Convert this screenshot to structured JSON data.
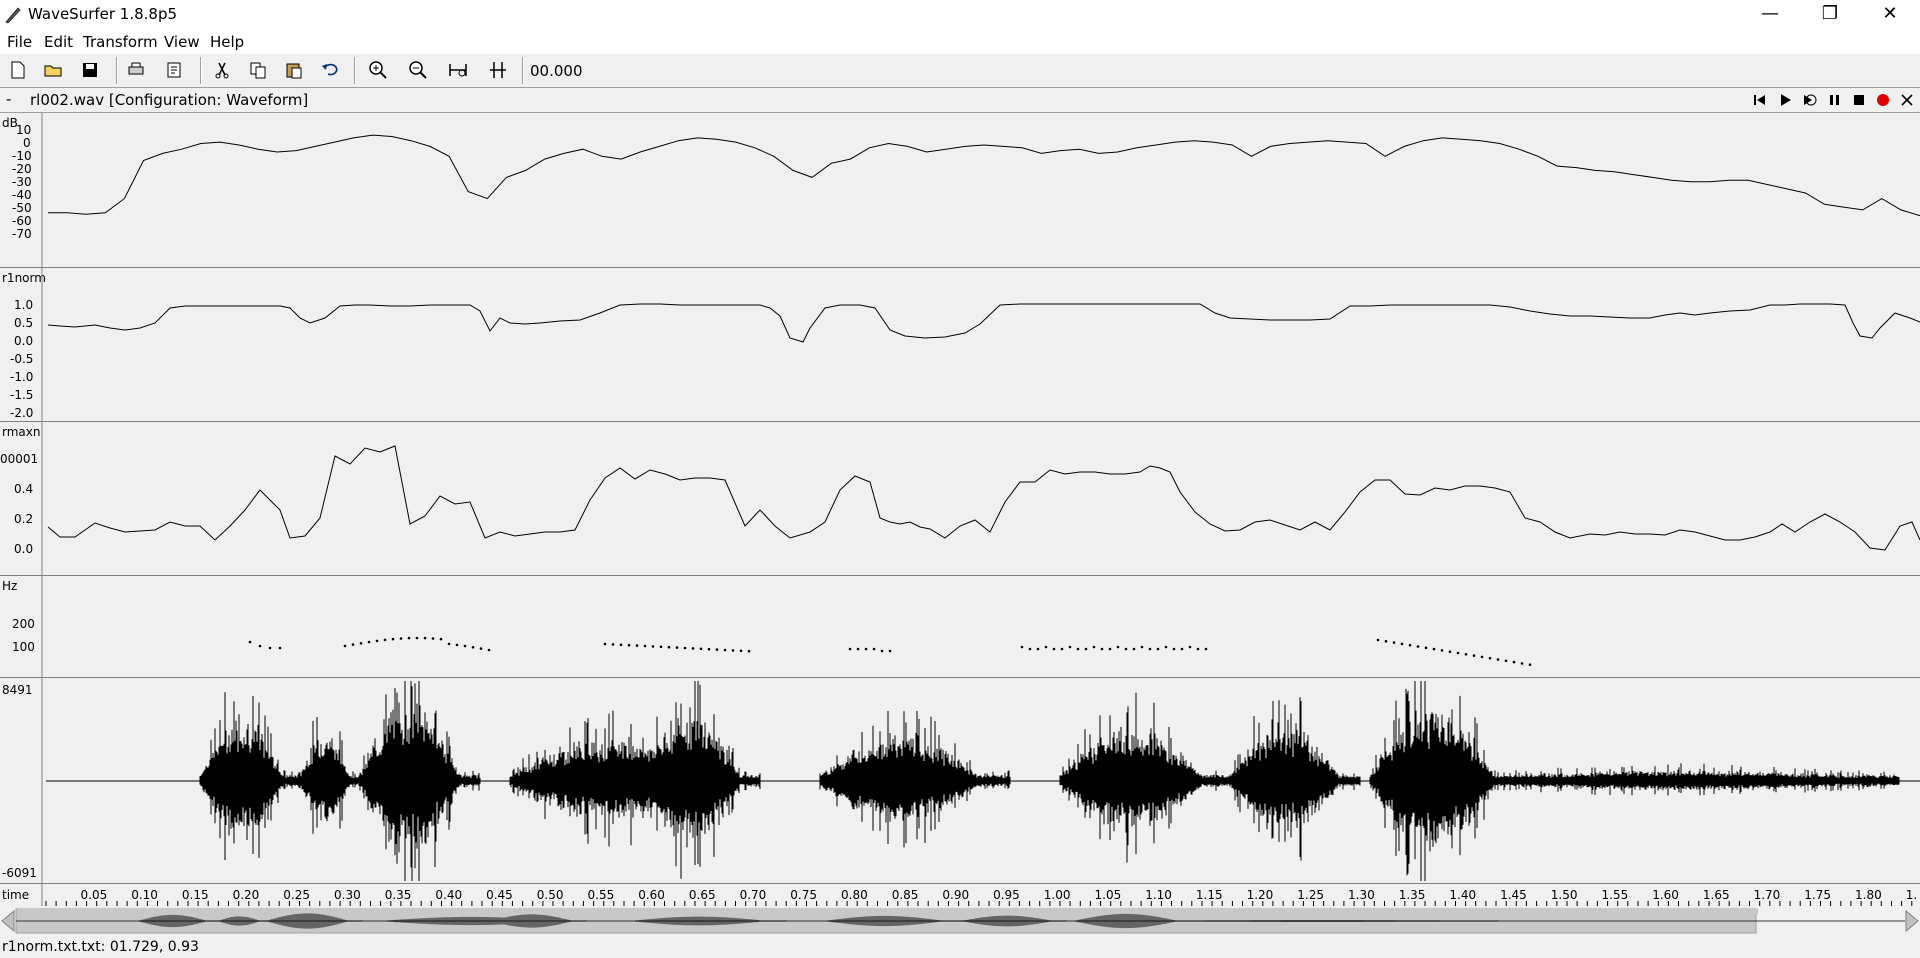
{
  "window": {
    "title": "WaveSurfer 1.8.8p5",
    "minimize": "—",
    "maximize": "❐",
    "close": "✕"
  },
  "menu": [
    "File",
    "Edit",
    "Transform",
    "View",
    "Help"
  ],
  "toolbar": {
    "time_readout": "00.000"
  },
  "file": {
    "dash": "-",
    "title": "rl002.wav [Configuration: Waveform]"
  },
  "panes": {
    "power": {
      "label": "dB",
      "ticks": [
        "10",
        "0",
        "-10",
        "-20",
        "-30",
        "-40",
        "-50",
        "-60",
        "-70"
      ]
    },
    "r1norm": {
      "label": "r1norm",
      "ticks": [
        "1.0",
        "0.5",
        "0.0",
        "-0.5",
        "-1.0",
        "-1.5",
        "-2.0"
      ]
    },
    "rmax": {
      "label": "rmaxn",
      "ticks": [
        "00001",
        "0.4",
        "0.2",
        "0.0"
      ]
    },
    "pitch": {
      "label": "Hz",
      "ticks": [
        "200",
        "100"
      ]
    },
    "waveform": {
      "top_value": "8491",
      "bottom_value": "-6091"
    }
  },
  "time_axis": {
    "label": "time",
    "ticks": [
      "0.05",
      "0.10",
      "0.15",
      "0.20",
      "0.25",
      "0.30",
      "0.35",
      "0.40",
      "0.45",
      "0.50",
      "0.55",
      "0.60",
      "0.65",
      "0.70",
      "0.75",
      "0.80",
      "0.85",
      "0.90",
      "0.95",
      "1.00",
      "1.05",
      "1.10",
      "1.15",
      "1.20",
      "1.25",
      "1.30",
      "1.35",
      "1.40",
      "1.45",
      "1.50",
      "1.55",
      "1.60",
      "1.65",
      "1.70",
      "1.75",
      "1.80",
      "1."
    ]
  },
  "curves": {
    "power_db": [
      -50,
      -50,
      -51,
      -50,
      -40,
      -13,
      -8,
      -5,
      -1,
      0,
      -2,
      -5,
      -7,
      -6,
      -3,
      0,
      3,
      5,
      4,
      1,
      -3,
      -10,
      -35,
      -40,
      -25,
      -20,
      -12,
      -8,
      -5,
      -10,
      -12,
      -7,
      -3,
      1,
      3,
      2,
      0,
      -4,
      -10,
      -20,
      -25,
      -15,
      -12,
      -4,
      -1,
      -3,
      -7,
      -5,
      -3,
      -2,
      -3,
      -4,
      -8,
      -6,
      -5,
      -8,
      -7,
      -4,
      -2,
      0,
      1,
      0,
      -2,
      -10,
      -3,
      -1,
      0,
      1,
      0,
      -1,
      -10,
      -3,
      1,
      3,
      2,
      1,
      -1,
      -5,
      -10,
      -17,
      -18,
      -20,
      -21,
      -23,
      -25,
      -27,
      -28,
      -28,
      -27,
      -27,
      -30,
      -33,
      -36,
      -44,
      -46,
      -48,
      -40,
      -48,
      -52
    ]
  },
  "status": {
    "text": "r1norm.txt.txt: 01.729, 0.93"
  }
}
